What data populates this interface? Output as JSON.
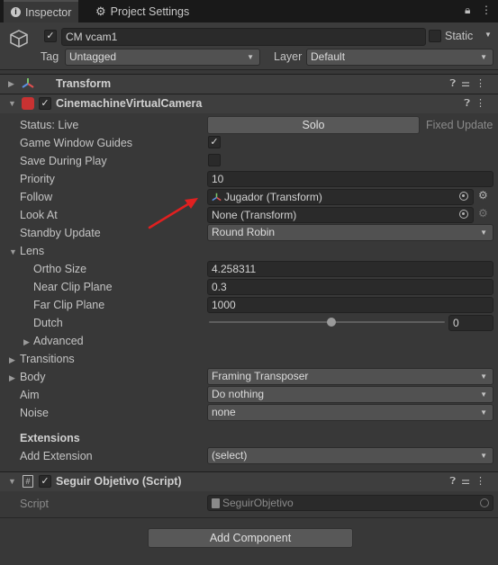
{
  "tabs": [
    {
      "label": "Inspector",
      "icon": "info-icon"
    },
    {
      "label": "Project Settings",
      "icon": "gear-icon"
    }
  ],
  "gameobject": {
    "active": true,
    "name": "CM vcam1",
    "static_label": "Static",
    "static": false,
    "tag_label": "Tag",
    "tag_value": "Untagged",
    "layer_label": "Layer",
    "layer_value": "Default"
  },
  "transform": {
    "title": "Transform"
  },
  "vcam": {
    "title": "CinemachineVirtualCamera",
    "enabled": true,
    "status_label": "Status: Live",
    "solo_button": "Solo",
    "fixed_update": "Fixed Update",
    "game_window_guides_label": "Game Window Guides",
    "game_window_guides": true,
    "save_during_play_label": "Save During Play",
    "save_during_play": false,
    "priority_label": "Priority",
    "priority_value": "10",
    "follow_label": "Follow",
    "follow_value": "Jugador (Transform)",
    "lookat_label": "Look At",
    "lookat_value": "None (Transform)",
    "standby_label": "Standby Update",
    "standby_value": "Round Robin",
    "lens_label": "Lens",
    "ortho_label": "Ortho Size",
    "ortho_value": "4.258311",
    "near_label": "Near Clip Plane",
    "near_value": "0.3",
    "far_label": "Far Clip Plane",
    "far_value": "1000",
    "dutch_label": "Dutch",
    "dutch_value": "0",
    "dutch_fraction": 0.5,
    "advanced_label": "Advanced",
    "transitions_label": "Transitions",
    "body_label": "Body",
    "body_value": "Framing Transposer",
    "aim_label": "Aim",
    "aim_value": "Do nothing",
    "noise_label": "Noise",
    "noise_value": "none",
    "extensions_label": "Extensions",
    "add_ext_label": "Add Extension",
    "add_ext_value": "(select)"
  },
  "script": {
    "title": "Seguir Objetivo (Script)",
    "enabled": true,
    "script_label": "Script",
    "script_value": "SeguirObjetivo"
  },
  "add_component": "Add Component",
  "colors": {
    "annotation_arrow": "#e02020"
  }
}
